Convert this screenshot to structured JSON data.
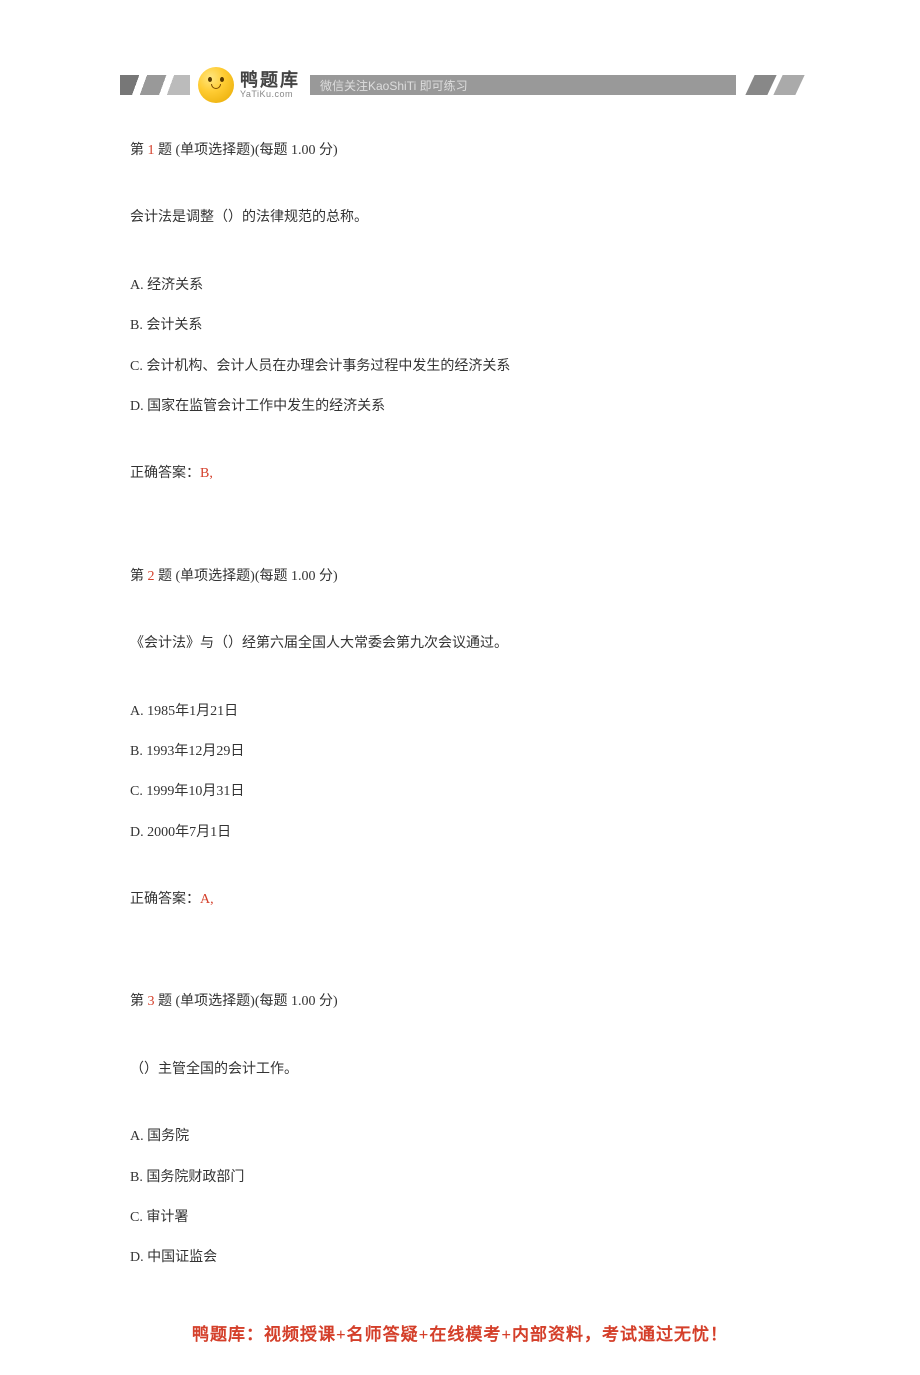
{
  "header": {
    "logo_title": "鸭题库",
    "logo_sub": "YaTiKu.com",
    "banner_text": "微信关注KaoShiTi 即可练习"
  },
  "questions": [
    {
      "num_prefix": "第 ",
      "num": "1",
      "rest": " 题 (单项选择题)(每题 1.00 分)",
      "stem": "会计法是调整（）的法律规范的总称。",
      "options": [
        "A. 经济关系",
        "B. 会计关系",
        "C. 会计机构、会计人员在办理会计事务过程中发生的经济关系",
        "D. 国家在监管会计工作中发生的经济关系"
      ],
      "answer_label": "正确答案：",
      "answer_value": "B,"
    },
    {
      "num_prefix": "第 ",
      "num": "2",
      "rest": " 题 (单项选择题)(每题 1.00 分)",
      "stem": "《会计法》与（）经第六届全国人大常委会第九次会议通过。",
      "options": [
        "A. 1985年1月21日",
        "B. 1993年12月29日",
        "C. 1999年10月31日",
        "D. 2000年7月1日"
      ],
      "answer_label": "正确答案：",
      "answer_value": "A,"
    },
    {
      "num_prefix": "第 ",
      "num": "3",
      "rest": " 题 (单项选择题)(每题 1.00 分)",
      "stem": " （）主管全国的会计工作。",
      "options": [
        "A. 国务院",
        "B. 国务院财政部门",
        "C. 审计署",
        "D. 中国证监会"
      ],
      "answer_label": "",
      "answer_value": ""
    }
  ],
  "footer": {
    "text": "鸭题库：视频授课+名师答疑+在线模考+内部资料，考试通过无忧！"
  }
}
